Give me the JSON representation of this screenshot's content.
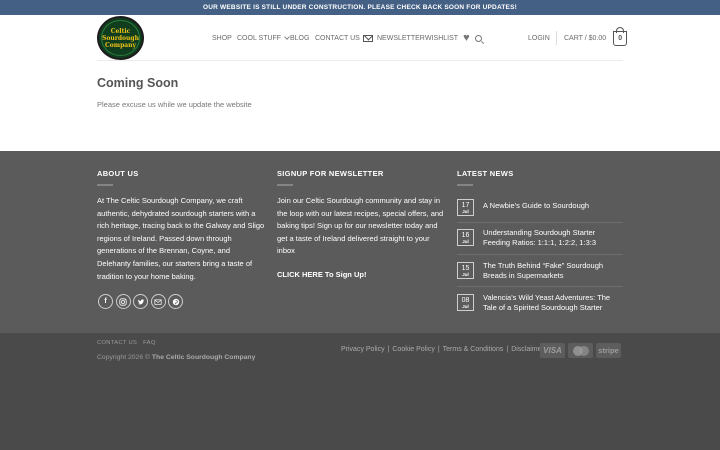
{
  "notice": "Our website is still under construction. Please check back soon for updates!",
  "logo": {
    "line1": "Celtic",
    "line2": "Sourdough",
    "line3": "Company"
  },
  "nav": {
    "shop": "SHOP",
    "cool_stuff": "COOL STUFF",
    "blog": "BLOG",
    "contact": "CONTACT US",
    "newsletter": "NEWSLETTER",
    "wishlist": "WISHLIST",
    "login": "LOGIN",
    "cart": "CART / $0.00",
    "cart_count": "0"
  },
  "main": {
    "title": "Coming Soon",
    "text": "Please excuse us while we update the website"
  },
  "footer": {
    "about": {
      "title": "ABOUT US",
      "text": "At The Celtic Sourdough Company, we craft authentic, dehydrated sourdough starters with a rich heritage, tracing back to the Galway and Sligo regions of Ireland. Passed down through generations of the Brennan, Coyne, and Delehanty families, our starters bring a taste of tradition to your home baking."
    },
    "signup": {
      "title": "SIGNUP FOR NEWSLETTER",
      "text": "Join our Celtic Sourdough community and stay in the loop with our latest recipes, special offers, and baking tips! Sign up for our newsletter today and get a taste of Ireland delivered straight to your inbox",
      "link": "CLICK HERE To Sign Up!"
    },
    "latest": {
      "title": "LATEST NEWS",
      "posts": [
        {
          "day": "17",
          "month": "Jul",
          "title": "A Newbie's Guide to Sourdough"
        },
        {
          "day": "16",
          "month": "Jul",
          "title": "Understanding Sourdough Starter Feeding Ratios: 1:1:1, 1:2:2, 1:3:3"
        },
        {
          "day": "15",
          "month": "Jul",
          "title": "The Truth Behind “Fake” Sourdough Breads in Supermarkets"
        },
        {
          "day": "08",
          "month": "Jul",
          "title": "Valencia's Wild Yeast Adventures: The Tale of a Spirited Sourdough Starter"
        }
      ]
    }
  },
  "bottom": {
    "contact": "CONTACT US",
    "faq": "FAQ",
    "copyright_prefix": "Copyright 2026 ©",
    "copyright_name": "The Celtic Sourdough Company",
    "privacy": "Privacy Policy",
    "cookie": "Cookie Policy",
    "terms": "Terms & Conditions",
    "disclaimer": "Disclaimer",
    "sep": "|",
    "visa": "VISA",
    "stripe": "stripe"
  }
}
